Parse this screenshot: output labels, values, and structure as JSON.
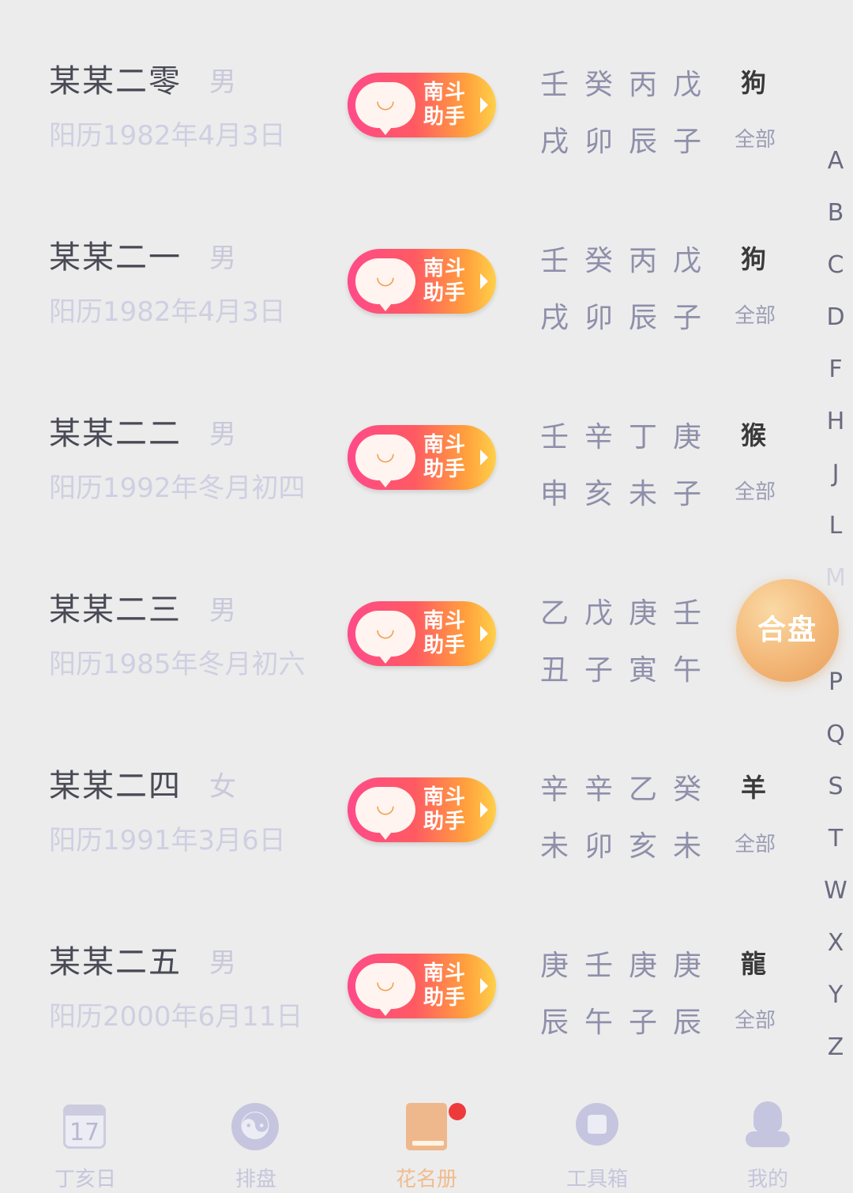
{
  "records": [
    {
      "name": "某某二零",
      "gender": "男",
      "date": "阳历1982年4月3日",
      "assistant": "南斗助手",
      "stems": "壬癸丙戊",
      "branches": "戌卯辰子",
      "zodiac": "狗",
      "tag": "全部"
    },
    {
      "name": "某某二一",
      "gender": "男",
      "date": "阳历1982年4月3日",
      "assistant": "南斗助手",
      "stems": "壬癸丙戊",
      "branches": "戌卯辰子",
      "zodiac": "狗",
      "tag": "全部"
    },
    {
      "name": "某某二二",
      "gender": "男",
      "date": "阳历1992年冬月初四",
      "assistant": "南斗助手",
      "stems": "壬辛丁庚",
      "branches": "申亥未子",
      "zodiac": "猴",
      "tag": "全部"
    },
    {
      "name": "某某二三",
      "gender": "男",
      "date": "阳历1985年冬月初六",
      "assistant": "南斗助手",
      "stems": "乙戊庚壬",
      "branches": "丑子寅午",
      "zodiac": "",
      "tag": ""
    },
    {
      "name": "某某二四",
      "gender": "女",
      "date": "阳历1991年3月6日",
      "assistant": "南斗助手",
      "stems": "辛辛乙癸",
      "branches": "未卯亥未",
      "zodiac": "羊",
      "tag": "全部"
    },
    {
      "name": "某某二五",
      "gender": "男",
      "date": "阳历2000年6月11日",
      "assistant": "南斗助手",
      "stems": "庚壬庚庚",
      "branches": "辰午子辰",
      "zodiac": "龍",
      "tag": "全部"
    }
  ],
  "index_letters": [
    "A",
    "B",
    "C",
    "D",
    "F",
    "H",
    "J",
    "L",
    "M",
    "",
    "P",
    "Q",
    "S",
    "T",
    "W",
    "X",
    "Y",
    "Z"
  ],
  "merge_button": "合盘",
  "tabs": [
    {
      "label": "丁亥日",
      "icon": "calendar-icon",
      "calendar_day": "17"
    },
    {
      "label": "排盘",
      "icon": "yin-yang-icon"
    },
    {
      "label": "花名册",
      "icon": "book-icon"
    },
    {
      "label": "工具箱",
      "icon": "toolbox-icon"
    },
    {
      "label": "我的",
      "icon": "person-icon"
    }
  ],
  "colors": {
    "background": "#ececec",
    "assistant_gradient_start": "#ff4a8a",
    "assistant_gradient_end": "#ffd04a",
    "merge_button": "#f3b777",
    "active_tab": "#f0bc8e",
    "notification_dot": "#ee3a3a"
  }
}
